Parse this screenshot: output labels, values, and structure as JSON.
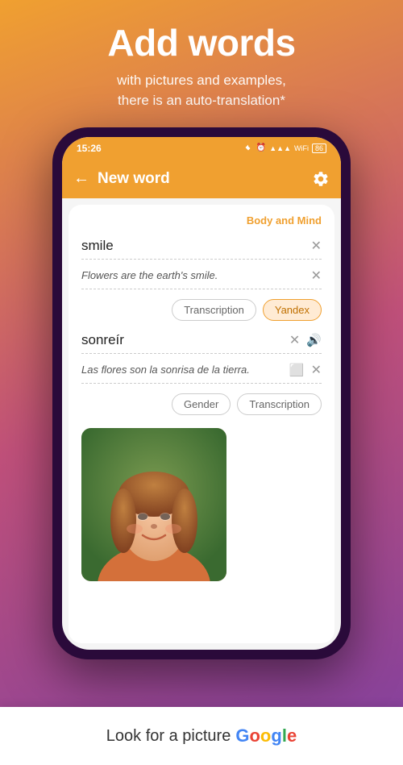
{
  "hero": {
    "title": "Add words",
    "subtitle_line1": "with pictures and examples,",
    "subtitle_line2": "there is an auto-translation*"
  },
  "status_bar": {
    "time": "15:26",
    "icons": "🔵 ⏰ 📶 WiFi 🔋"
  },
  "header": {
    "title": "New word",
    "back_icon": "←",
    "settings_icon": "⚙"
  },
  "content": {
    "category": "Body and Mind",
    "word_placeholder": "smile",
    "example_placeholder": "Flowers are the earth's smile.",
    "transcription_btn": "Transcription",
    "yandex_btn": "Yandex",
    "translation": "sonreír",
    "translation_example": "Las flores son la sonrisa de la tierra.",
    "gender_btn": "Gender",
    "transcription_btn2": "Transcription"
  },
  "google_bar": {
    "look_text": "Look for a picture",
    "google_text": "Google"
  }
}
